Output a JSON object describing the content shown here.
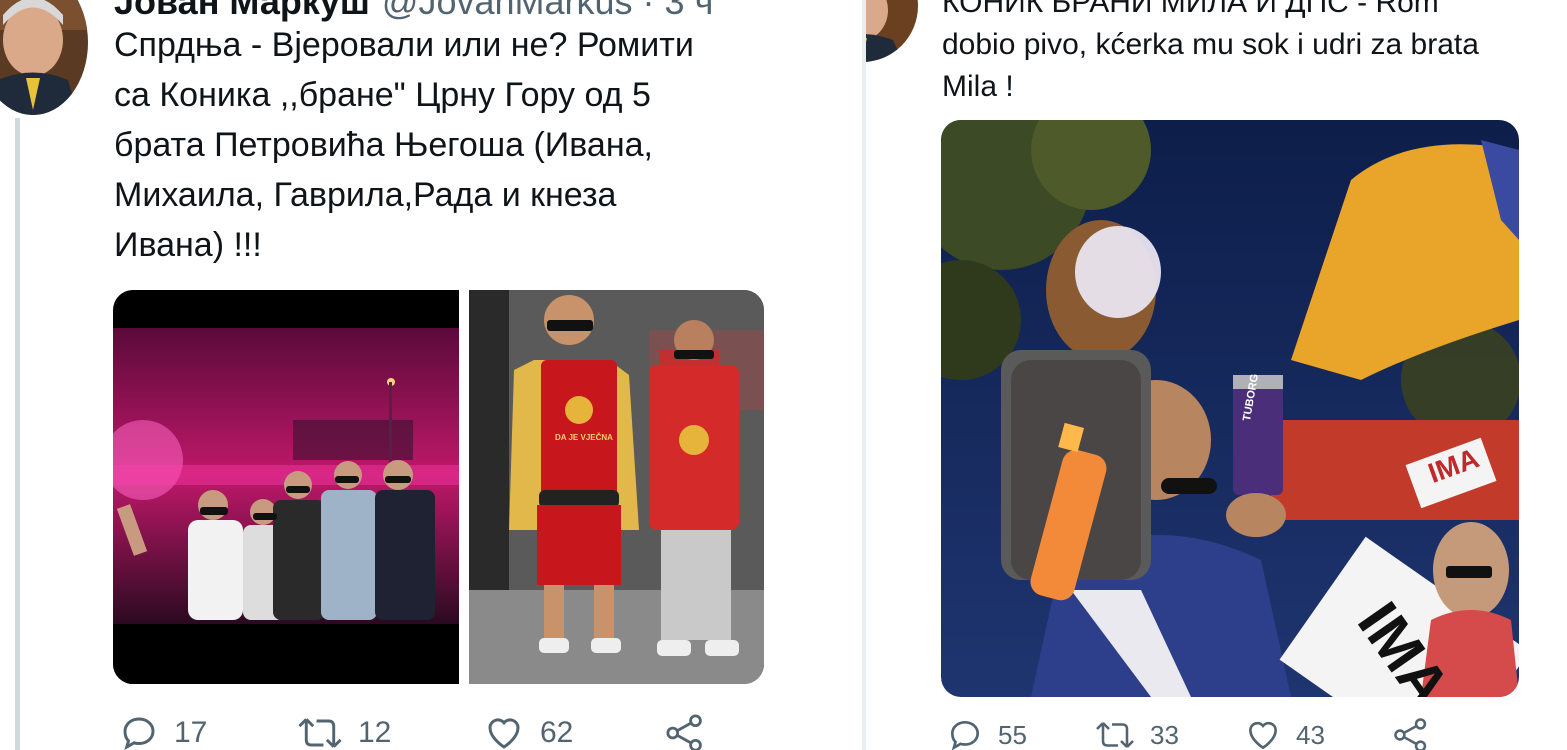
{
  "left_tweet": {
    "author_name": "Јован Маркуш",
    "handle": "@JovanMarkus · 3 ч",
    "text": "Спрдња - Вјеровали или не? Ромити\nса Коника ,,бране\" Црну Гору од 5\nбрата Петровића Његоша (Ивана,\nМихаила, Гаврила,Рада и кнеза\nИвана) !!!",
    "shirt_text": "DA JE VJEČNA",
    "replies": "17",
    "retweets": "12",
    "likes": "62"
  },
  "right_tweet": {
    "text": "КОНИК БРАНИ МИЛА И ДПС - Rom\ndobio pivo, kćerka mu sok i udri za brata\nMila !",
    "can_label": "TUBORG",
    "sign_text": "IMA",
    "replies": "55",
    "retweets": "33",
    "likes": "43"
  },
  "colors": {
    "thread": "#cfd9de",
    "action": "#536471",
    "text": "#0f1419"
  },
  "icons": [
    "reply-icon",
    "retweet-icon",
    "like-icon",
    "share-icon"
  ]
}
